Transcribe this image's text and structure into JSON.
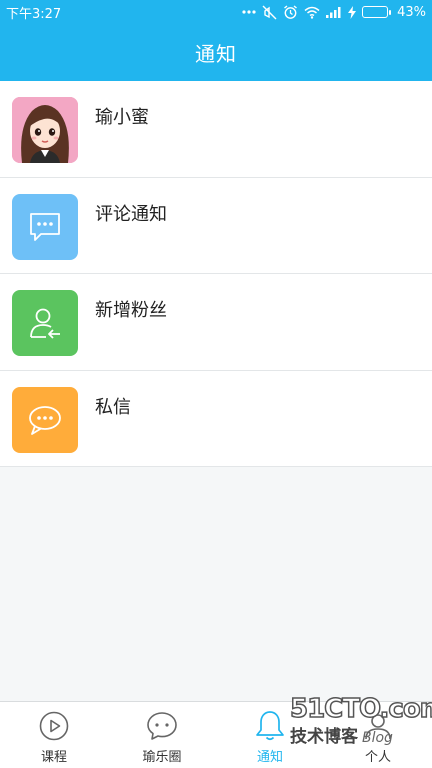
{
  "status_bar": {
    "time": "下午3:27",
    "battery_percent": "43%",
    "battery_level": 0.43,
    "icons": [
      "more-dots-icon",
      "mute-icon",
      "alarm-icon",
      "wifi-icon",
      "signal-icon",
      "charging-icon",
      "battery-icon"
    ]
  },
  "header": {
    "title": "通知"
  },
  "list": {
    "items": [
      {
        "label": "瑜小蜜",
        "icon": "user-avatar",
        "color": "#f3a7c4"
      },
      {
        "label": "评论通知",
        "icon": "comment-icon",
        "color": "#6ec0f7"
      },
      {
        "label": "新增粉丝",
        "icon": "new-follower-icon",
        "color": "#5bc45f"
      },
      {
        "label": "私信",
        "icon": "private-message-icon",
        "color": "#ffac3a"
      }
    ]
  },
  "bottom_nav": {
    "items": [
      {
        "label": "课程",
        "icon": "play-icon",
        "active": false
      },
      {
        "label": "瑜乐圈",
        "icon": "chat-bubble-icon",
        "active": false
      },
      {
        "label": "通知",
        "icon": "bell-icon",
        "active": true
      },
      {
        "label": "个人",
        "icon": "person-icon",
        "active": false
      }
    ]
  },
  "watermark": {
    "site": "51CTO.com",
    "tagline_cn": "技术博客",
    "tagline_en": "Blog"
  },
  "colors": {
    "accent": "#21b5ee",
    "background": "#f5f7f8"
  }
}
